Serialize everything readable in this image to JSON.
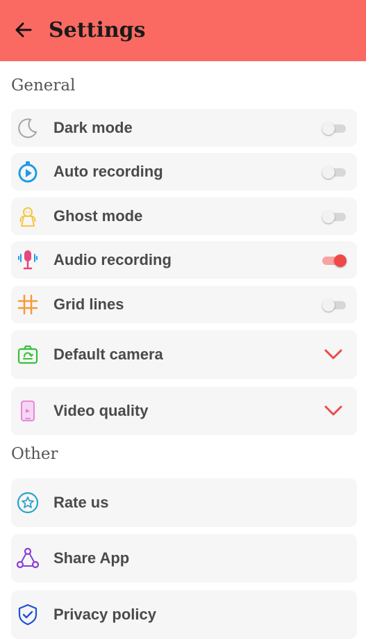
{
  "header": {
    "title": "Settings"
  },
  "sections": {
    "general": "General",
    "other": "Other"
  },
  "general_items": [
    {
      "label": "Dark mode",
      "icon": "moon-icon",
      "toggle": false
    },
    {
      "label": "Auto recording",
      "icon": "timer-play-icon",
      "toggle": false
    },
    {
      "label": "Ghost mode",
      "icon": "ghost-icon",
      "toggle": false
    },
    {
      "label": "Audio recording",
      "icon": "microphone-icon",
      "toggle": true
    },
    {
      "label": "Grid lines",
      "icon": "grid-icon",
      "toggle": false
    },
    {
      "label": "Default camera",
      "icon": "camera-switch-icon",
      "control": "dropdown"
    },
    {
      "label": "Video quality",
      "icon": "phone-video-icon",
      "control": "dropdown"
    }
  ],
  "other_items": [
    {
      "label": "Rate us",
      "icon": "star-icon"
    },
    {
      "label": "Share App",
      "icon": "share-icon"
    },
    {
      "label": "Privacy policy",
      "icon": "shield-icon"
    }
  ],
  "colors": {
    "header": "#fa6a62",
    "accent": "#f04848",
    "card": "#f6f6f6"
  }
}
